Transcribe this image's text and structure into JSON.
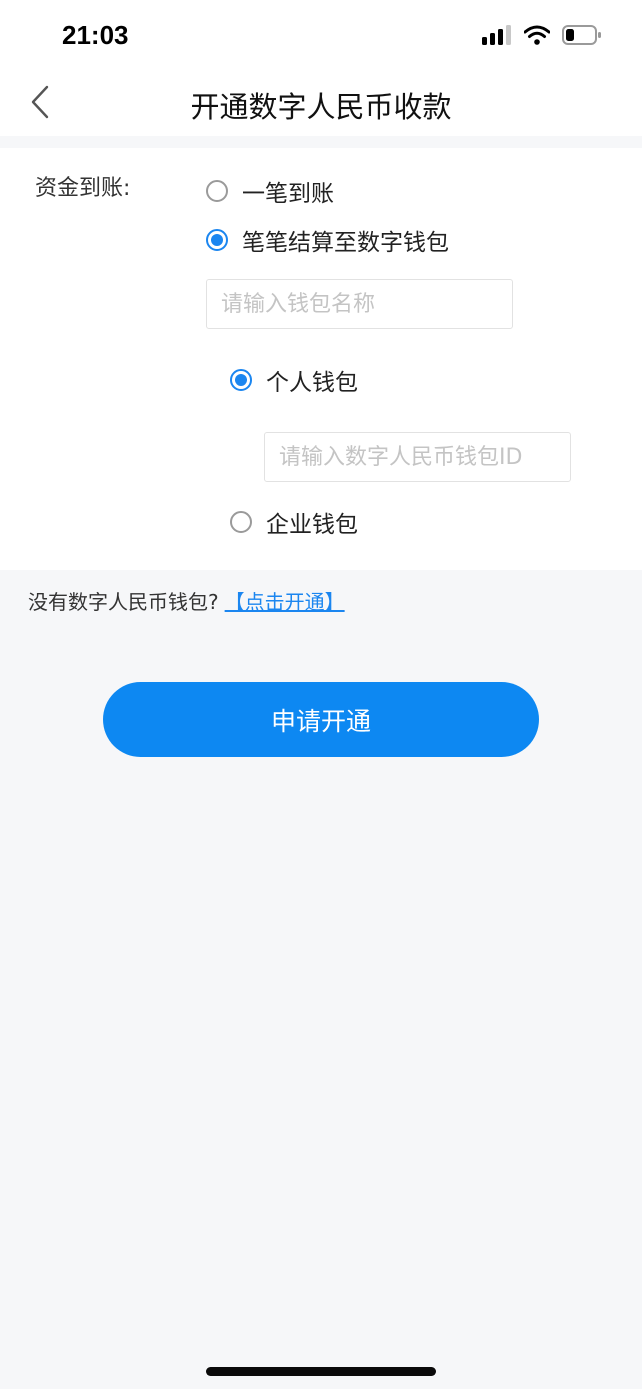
{
  "status_bar": {
    "time": "21:03",
    "icons": [
      "cellular-signal-icon",
      "wifi-icon",
      "battery-icon"
    ]
  },
  "nav": {
    "title": "开通数字人民币收款",
    "back_icon": "chevron-left-icon"
  },
  "form": {
    "label": "资金到账:",
    "options": [
      {
        "label": "一笔到账",
        "checked": false
      },
      {
        "label": "笔笔结算至数字钱包",
        "checked": true
      }
    ],
    "wallet_name_placeholder": "请输入钱包名称",
    "wallet_types": [
      {
        "label": "个人钱包",
        "checked": true
      },
      {
        "label": "企业钱包",
        "checked": false
      }
    ],
    "wallet_id_placeholder": "请输入数字人民币钱包ID"
  },
  "hint": {
    "text": "没有数字人民币钱包?",
    "link": "【点击开通】"
  },
  "submit": {
    "label": "申请开通"
  },
  "colors": {
    "accent": "#1b86f0",
    "button": "#0d88f2",
    "page_bg": "#f6f7f9"
  }
}
